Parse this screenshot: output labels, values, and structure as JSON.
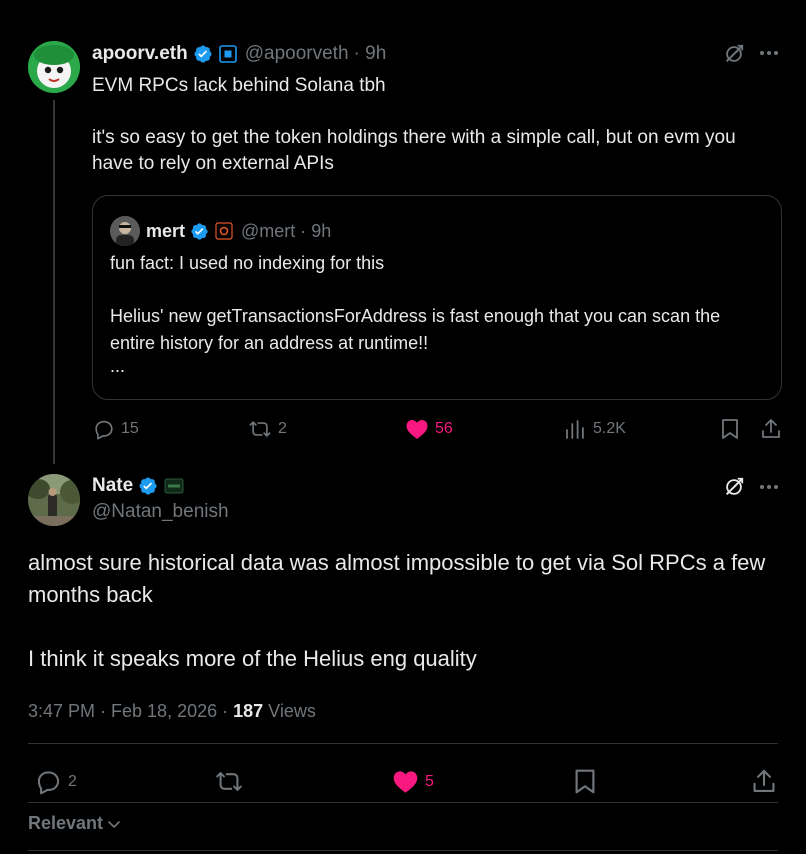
{
  "parent_tweet": {
    "display_name": "apoorv.eth",
    "handle": "@apoorveth",
    "time": "· 9h",
    "text_line1": "EVM RPCs lack behind Solana tbh",
    "text_line2": "it's so easy to get the token holdings there with a simple call, but on evm you have to rely on external APIs",
    "quote": {
      "display_name": "mert",
      "handle": "@mert",
      "time": "· 9h",
      "text_line1": "fun fact: I used no indexing for this",
      "text_line2": "Helius' new getTransactionsForAddress is fast enough that you can scan the entire history for an address at runtime!!",
      "ellipsis": "..."
    },
    "actions": {
      "replies": "15",
      "reposts": "2",
      "likes": "56",
      "views": "5.2K"
    }
  },
  "reply_tweet": {
    "display_name": "Nate",
    "handle": "@Natan_benish",
    "text_line1": "almost sure historical data was almost impossible to get via Sol RPCs a few months back",
    "text_line2": "I think it speaks more of the Helius eng quality",
    "meta_time": "3:47 PM · Feb 18, 2026 · ",
    "views_count": "187",
    "views_label": " Views",
    "actions": {
      "replies": "2",
      "likes": "5"
    }
  },
  "sort": {
    "label": "Relevant"
  },
  "colors": {
    "background": "#000000",
    "text": "#e7e9ea",
    "muted": "#71767b",
    "verified": "#1d9bf0",
    "like": "#f91880",
    "border": "#2f3336"
  },
  "icons": {
    "verified": "verified-badge-icon",
    "grok": "grok-icon",
    "more": "more-icon",
    "reply": "reply-icon",
    "repost": "repost-icon",
    "like": "heart-icon",
    "views": "views-icon",
    "bookmark": "bookmark-icon",
    "share": "share-icon",
    "chevron": "chevron-down-icon"
  }
}
